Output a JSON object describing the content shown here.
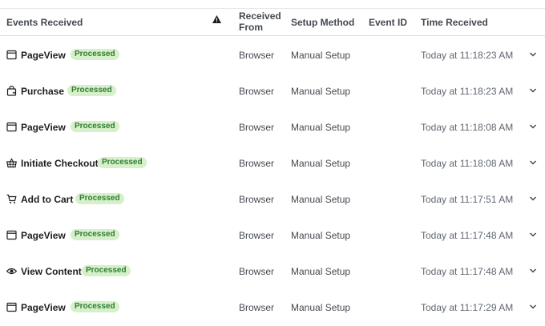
{
  "header": {
    "events_received": "Events Received",
    "warning_icon": "warning-icon",
    "received_from": "Received From",
    "setup_method": "Setup Method",
    "event_id": "Event ID",
    "time_received": "Time Received"
  },
  "colors": {
    "badge_bg": "#d6f0c9",
    "badge_text": "#2e7d32"
  },
  "rows": [
    {
      "icon": "page-icon",
      "event": "PageView",
      "status": "Processed",
      "received_from": "Browser",
      "setup_method": "Manual Setup",
      "event_id": "",
      "time": "Today at 11:18:23 AM"
    },
    {
      "icon": "purchase-bag-icon",
      "event": "Purchase",
      "status": "Processed",
      "received_from": "Browser",
      "setup_method": "Manual Setup",
      "event_id": "",
      "time": "Today at 11:18:23 AM"
    },
    {
      "icon": "page-icon",
      "event": "PageView",
      "status": "Processed",
      "received_from": "Browser",
      "setup_method": "Manual Setup",
      "event_id": "",
      "time": "Today at 11:18:08 AM"
    },
    {
      "icon": "basket-icon",
      "event": "Initiate Checkout",
      "status": "Processed",
      "received_from": "Browser",
      "setup_method": "Manual Setup",
      "event_id": "",
      "time": "Today at 11:18:08 AM"
    },
    {
      "icon": "cart-icon",
      "event": "Add to Cart",
      "status": "Processed",
      "received_from": "Browser",
      "setup_method": "Manual Setup",
      "event_id": "",
      "time": "Today at 11:17:51 AM"
    },
    {
      "icon": "page-icon",
      "event": "PageView",
      "status": "Processed",
      "received_from": "Browser",
      "setup_method": "Manual Setup",
      "event_id": "",
      "time": "Today at 11:17:48 AM"
    },
    {
      "icon": "eye-icon",
      "event": "View Content",
      "status": "Processed",
      "received_from": "Browser",
      "setup_method": "Manual Setup",
      "event_id": "",
      "time": "Today at 11:17:48 AM"
    },
    {
      "icon": "page-icon",
      "event": "PageView",
      "status": "Processed",
      "received_from": "Browser",
      "setup_method": "Manual Setup",
      "event_id": "",
      "time": "Today at 11:17:29 AM"
    }
  ]
}
